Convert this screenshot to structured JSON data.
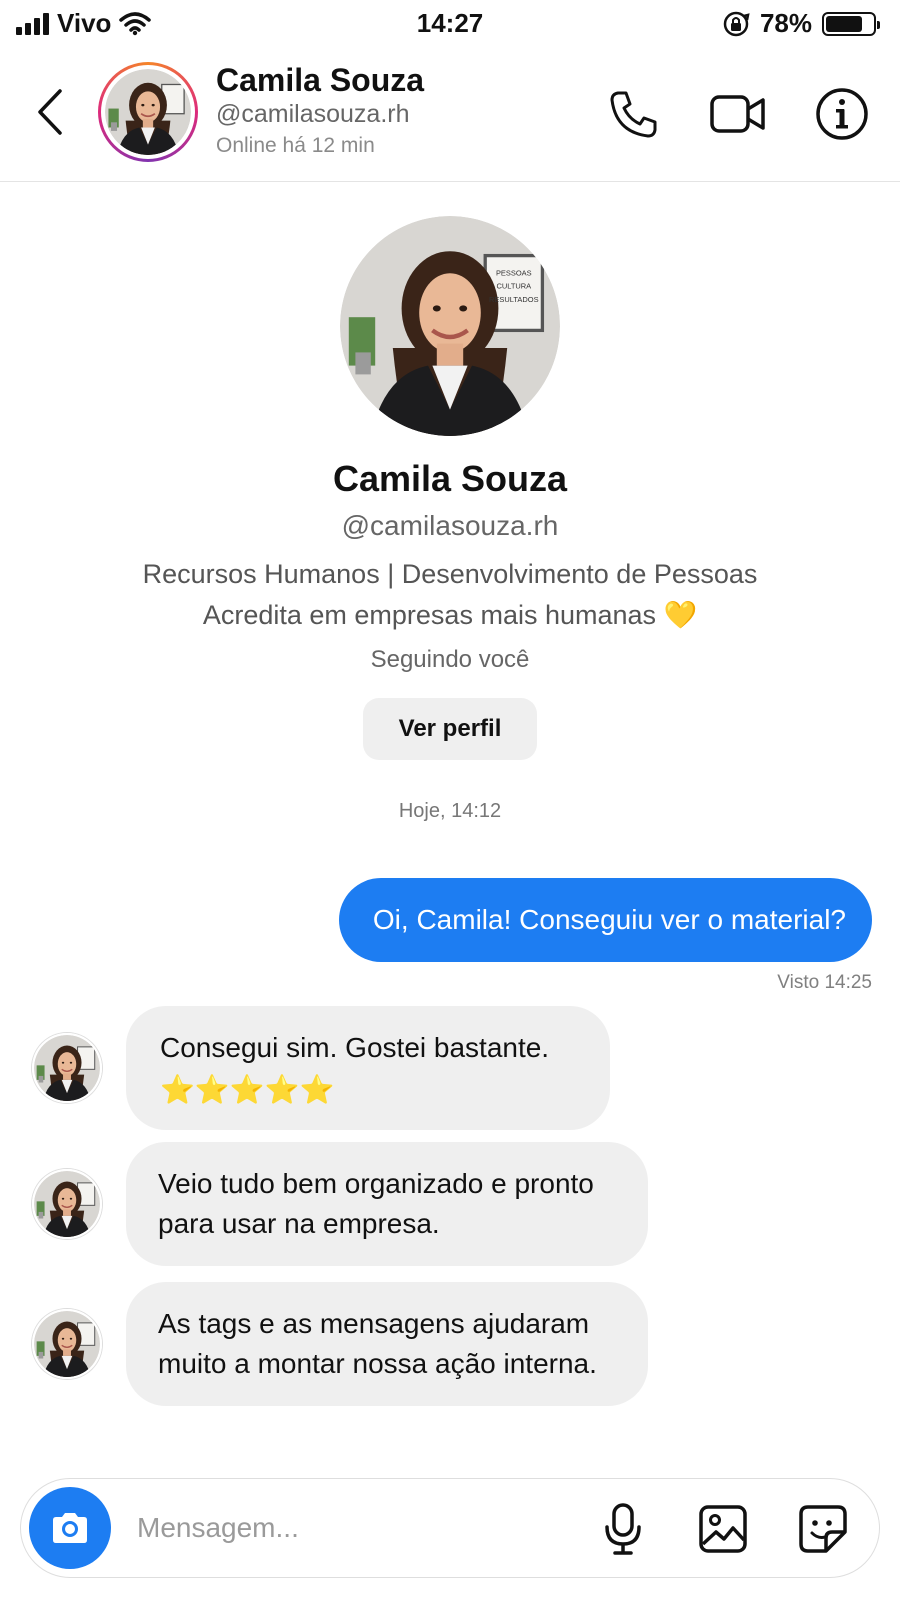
{
  "status_bar": {
    "carrier": "Vivo",
    "time": "14:27",
    "battery": "78%",
    "battery_level": 0.78
  },
  "header": {
    "name": "Camila Souza",
    "handle": "@camilasouza.rh",
    "status": "Online há 12 min"
  },
  "profile": {
    "name": "Camila Souza",
    "handle": "@camilasouza.rh",
    "bio_line1": "Recursos Humanos | Desenvolvimento de Pessoas",
    "bio_line2": "Acredita em empresas mais humanas 💛",
    "follow_status": "Seguindo você",
    "view_profile_label": "Ver perfil",
    "poster_text": [
      "PESSOAS",
      "CULTURA",
      "RESULTADOS"
    ]
  },
  "chat": {
    "date_separator": "Hoje, 14:12",
    "outgoing": {
      "text": "Oi, Camila! Conseguiu ver o material?",
      "seen": "Visto 14:25"
    },
    "incoming": [
      {
        "line1": "Consegui sim. Gostei bastante.",
        "stars": "⭐⭐⭐⭐⭐"
      },
      {
        "line1": "Veio tudo bem organizado e pronto",
        "line2": "para usar na empresa."
      },
      {
        "line1": "As tags e as mensagens ajudaram",
        "line2": "muito a montar nossa ação interna."
      }
    ]
  },
  "composer": {
    "placeholder": "Mensagem..."
  },
  "colors": {
    "accent": "#1d7df2",
    "bubble_in": "#efefef",
    "story_ring": [
      "#f58529",
      "#dd2a7b",
      "#8134af"
    ]
  },
  "icons": {
    "back": "chevron-left-icon",
    "call": "phone-icon",
    "video": "video-camera-icon",
    "info": "info-icon",
    "camera": "camera-icon",
    "mic": "microphone-icon",
    "gallery": "image-icon",
    "sticker": "sticker-icon"
  }
}
